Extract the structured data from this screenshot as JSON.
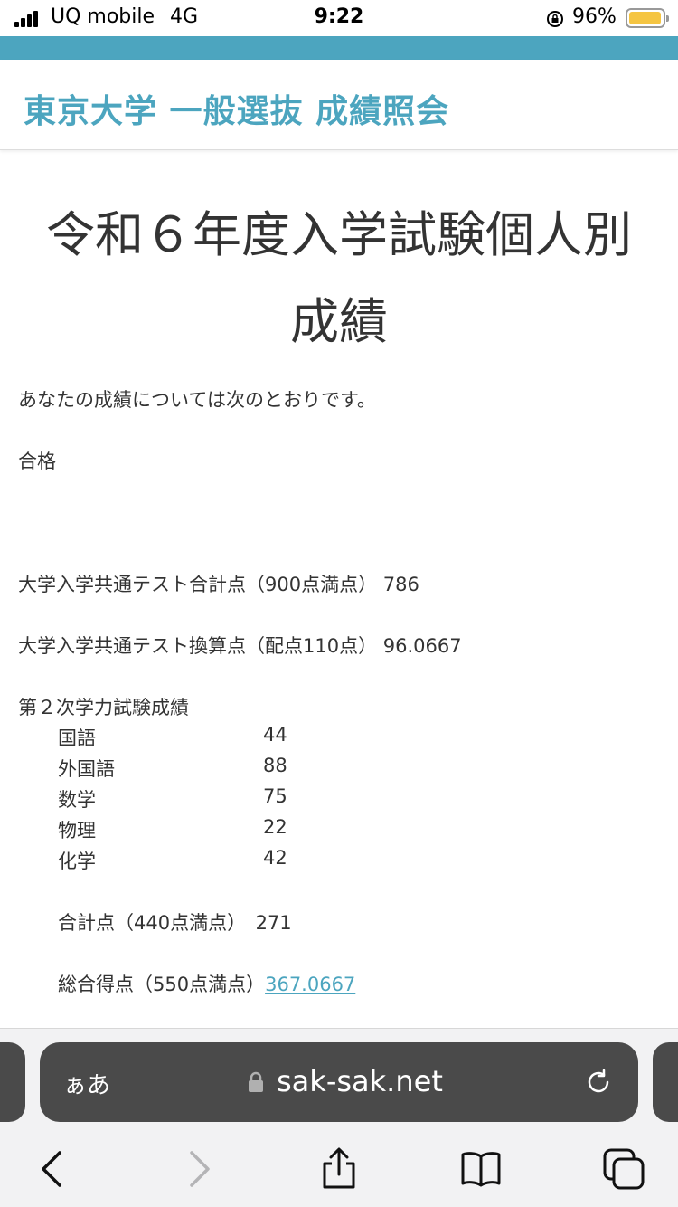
{
  "status_bar": {
    "carrier": "UQ mobile",
    "network": "4G",
    "time": "9:22",
    "battery_percent": "96%",
    "battery_level": 0.96,
    "battery_color": "#f5c542"
  },
  "theme": {
    "accent": "#4ca5bf"
  },
  "header": {
    "site_title": "東京大学 一般選抜 成績照会"
  },
  "main": {
    "title": "令和６年度入学試験個人別成績",
    "intro": "あなたの成績については次のとおりです。",
    "result": "合格",
    "common_test_total": "大学入学共通テスト合計点（900点満点） 786",
    "common_test_converted": "大学入学共通テスト換算点（配点110点） 96.0667",
    "second_exam_heading": "第２次学力試験成績",
    "subjects": [
      {
        "name": "国語",
        "score": "44"
      },
      {
        "name": "外国語",
        "score": "88"
      },
      {
        "name": "数学",
        "score": "75"
      },
      {
        "name": "物理",
        "score": "22"
      },
      {
        "name": "化学",
        "score": "42"
      }
    ],
    "second_total": "合計点（440点満点）　271",
    "overall_label": "総合得点（550点満点）",
    "overall_value": "367.0667"
  },
  "browser": {
    "text_size_button": "ぁあ",
    "url": "sak-sak.net",
    "icons": [
      "lock-icon",
      "reload-icon",
      "back-icon",
      "forward-icon",
      "share-icon",
      "bookmarks-icon",
      "tabs-icon"
    ]
  }
}
